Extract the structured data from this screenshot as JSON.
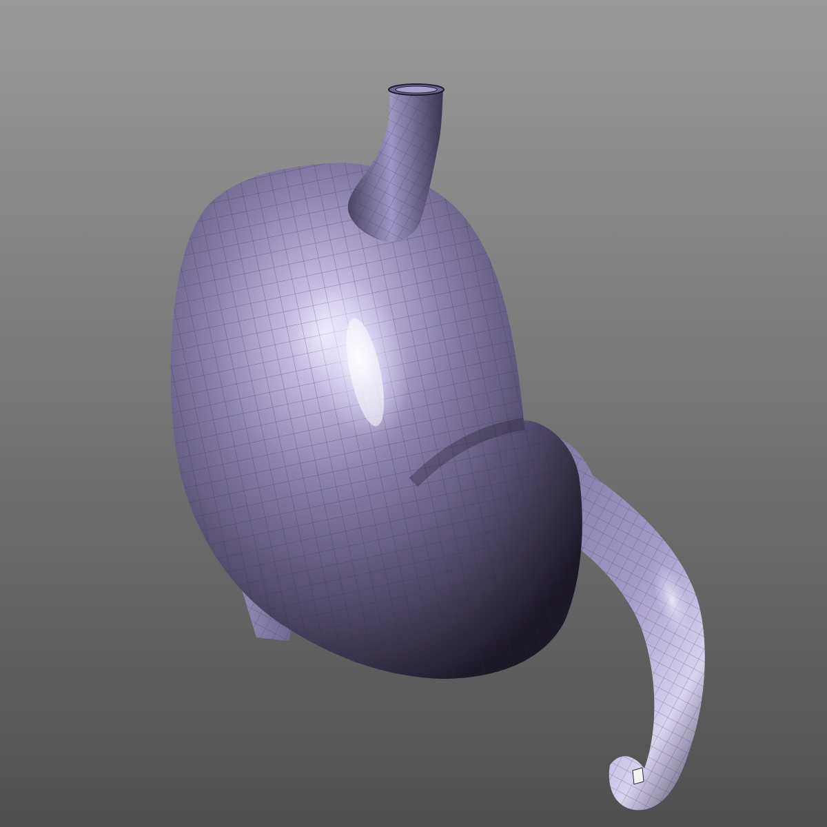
{
  "viewport": {
    "background_top": "#9a9a9a",
    "background_bottom": "#4f4f4f"
  },
  "model": {
    "subject": "stomach",
    "render_style": "shaded quad wireframe mesh",
    "surface_color": "#7e74a3",
    "highlight_color": "#f4f0ff",
    "shadow_color": "#1f1b2c",
    "wire_color": "#3a3550",
    "icons": [
      "stomach-mesh-icon"
    ]
  }
}
